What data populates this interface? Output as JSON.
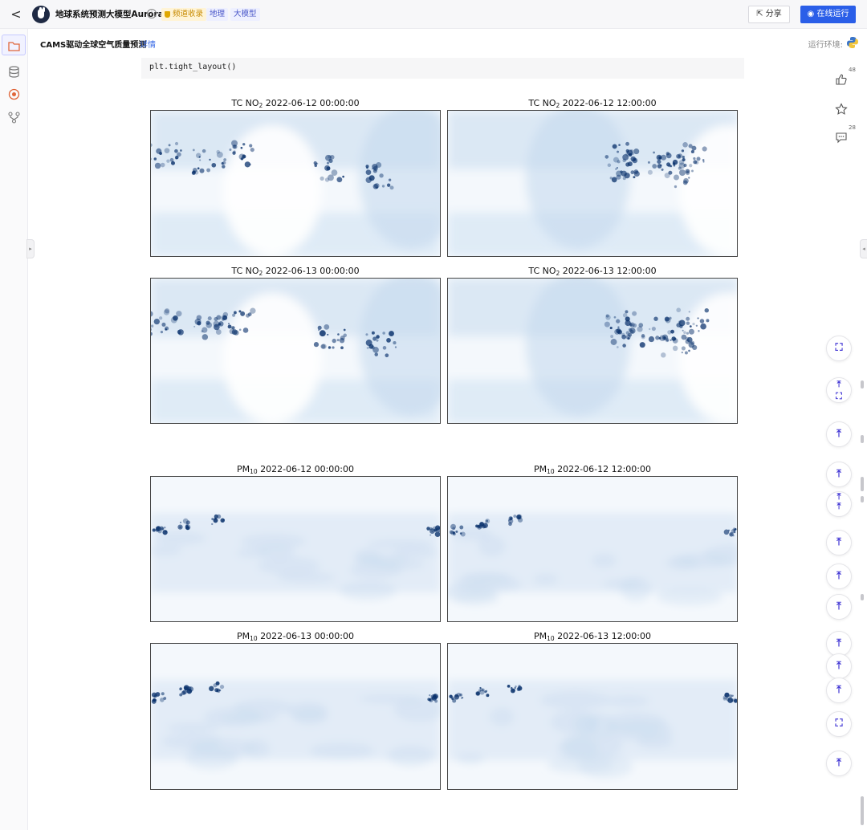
{
  "topbar": {
    "back": "<",
    "title": "地球系统预测大模型Aurora",
    "info": "i",
    "tag_collect": "频道收录",
    "tag_geo": "地理",
    "tag_model": "大模型",
    "share": "分享",
    "run": "在线运行"
  },
  "subheader": {
    "notebook_title": "CAMS驱动全球空气质量预测",
    "detail": "详情",
    "env_label": "运行环境:"
  },
  "code": {
    "line": "plt.tight_layout()"
  },
  "figures": {
    "no2": [
      {
        "var": "TC NO",
        "sub": "2",
        "time": "2022-06-12 00:00:00"
      },
      {
        "var": "TC NO",
        "sub": "2",
        "time": "2022-06-12 12:00:00"
      },
      {
        "var": "TC NO",
        "sub": "2",
        "time": "2022-06-13 00:00:00"
      },
      {
        "var": "TC NO",
        "sub": "2",
        "time": "2022-06-13 12:00:00"
      }
    ],
    "pm10": [
      {
        "var": "PM",
        "sub": "10",
        "time": "2022-06-12 00:00:00"
      },
      {
        "var": "PM",
        "sub": "10",
        "time": "2022-06-12 12:00:00"
      },
      {
        "var": "PM",
        "sub": "10",
        "time": "2022-06-13 00:00:00"
      },
      {
        "var": "PM",
        "sub": "10",
        "time": "2022-06-13 12:00:00"
      }
    ]
  },
  "right_rail": {
    "like_count": "48",
    "comment_count": "28"
  },
  "colors": {
    "accent": "#2a5ee8",
    "map_light": "#f4f8fc",
    "map_mid": "#c6dbef",
    "map_dark": "#08306b"
  }
}
